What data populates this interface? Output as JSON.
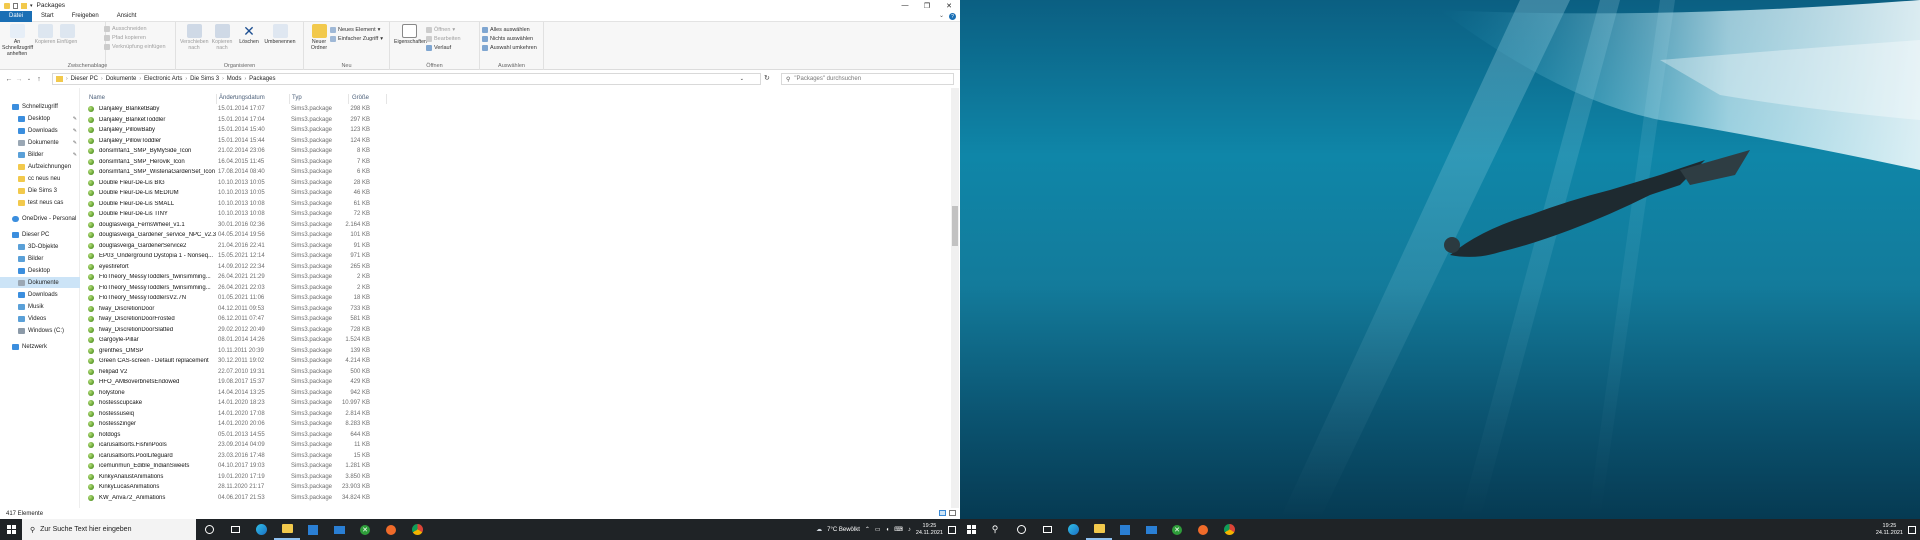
{
  "window": {
    "title": "Packages",
    "qa_dropdown": "▾",
    "minimize": "—",
    "maximize": "❐",
    "close": "✕",
    "help": "?"
  },
  "ribbon_tabs": [
    "Datei",
    "Start",
    "Freigeben",
    "Ansicht"
  ],
  "ribbon": {
    "pin_quick_access": "An Schnellzugriff anheften",
    "copy": "Kopieren",
    "paste": "Einfügen",
    "cut": "Ausschneiden",
    "copy_path": "Pfad kopieren",
    "paste_shortcut": "Verknüpfung einfügen",
    "group_clipboard": "Zwischenablage",
    "move_to": "Verschieben nach",
    "copy_to": "Kopieren nach",
    "delete": "Löschen",
    "rename": "Umbenennen",
    "group_organize": "Organisieren",
    "new_folder": "Neuer Ordner",
    "new_item": "Neues Element",
    "easy_access": "Einfacher Zugriff",
    "group_new": "Neu",
    "properties": "Eigenschaften",
    "open": "Öffnen",
    "edit": "Bearbeiten",
    "history": "Verlauf",
    "group_open": "Öffnen",
    "select_all": "Alles auswählen",
    "select_none": "Nichts auswählen",
    "invert_selection": "Auswahl umkehren",
    "group_select": "Auswählen"
  },
  "address": {
    "back": "←",
    "forward": "→",
    "recent": "⌄",
    "up": "↑",
    "crumbs": [
      "Dieser PC",
      "Dokumente",
      "Electronic Arts",
      "Die Sims 3",
      "Mods",
      "Packages"
    ],
    "dropdown": "⌄",
    "refresh": "↻",
    "search_placeholder": "\"Packages\" durchsuchen"
  },
  "nav_pane": {
    "quick_access": "Schnellzugriff",
    "desktop": "Desktop",
    "downloads": "Downloads",
    "documents": "Dokumente",
    "pictures": "Bilder",
    "recordings": "Aufzeichnungen",
    "cc_new": "cc neus neu",
    "sims3": "Die Sims 3",
    "test_cas": "test neus cas",
    "onedrive": "OneDrive - Personal",
    "this_pc": "Dieser PC",
    "objects3d": "3D-Objekte",
    "pc_pictures": "Bilder",
    "pc_desktop": "Desktop",
    "pc_documents": "Dokumente",
    "pc_downloads": "Downloads",
    "music": "Musik",
    "videos": "Videos",
    "windows_c": "Windows (C:)",
    "network": "Netzwerk"
  },
  "columns": {
    "name": "Name",
    "date": "Änderungsdatum",
    "type": "Typ",
    "size": "Größe",
    "sort_indicator": "^"
  },
  "files": [
    {
      "name": "Danjaley_BlanketBaby",
      "date": "15.01.2014 17:07",
      "type": "Sims3.package",
      "size": "298 KB"
    },
    {
      "name": "Danjaley_BlanketToddler",
      "date": "15.01.2014 17:04",
      "type": "Sims3.package",
      "size": "297 KB"
    },
    {
      "name": "Danjaley_PillowBaby",
      "date": "15.01.2014 15:40",
      "type": "Sims3.package",
      "size": "123 KB"
    },
    {
      "name": "Danjaley_PillowToddler",
      "date": "15.01.2014 15:44",
      "type": "Sims3.package",
      "size": "124 KB"
    },
    {
      "name": "donsimfan1_SMP_ByMySide_Icon",
      "date": "21.02.2014 23:06",
      "type": "Sims3.package",
      "size": "8 KB"
    },
    {
      "name": "donsimfan1_SMP_Herovik_Icon",
      "date": "16.04.2015 11:45",
      "type": "Sims3.package",
      "size": "7 KB"
    },
    {
      "name": "donsimfan1_SMP_WisteriaGardenSet_Icon",
      "date": "17.08.2014 08:40",
      "type": "Sims3.package",
      "size": "6 KB"
    },
    {
      "name": "Double Fleur-De-Lis BIG",
      "date": "10.10.2013 10:05",
      "type": "Sims3.package",
      "size": "28 KB"
    },
    {
      "name": "Double Fleur-De-Lis MEDIUM",
      "date": "10.10.2013 10:05",
      "type": "Sims3.package",
      "size": "46 KB"
    },
    {
      "name": "Double Fleur-De-Lis SMALL",
      "date": "10.10.2013 10:08",
      "type": "Sims3.package",
      "size": "61 KB"
    },
    {
      "name": "Double Fleur-De-Lis TINY",
      "date": "10.10.2013 10:08",
      "type": "Sims3.package",
      "size": "72 KB"
    },
    {
      "name": "douglasveiga_FerrisWheel_v1.1",
      "date": "30.01.2016 02:36",
      "type": "Sims3.package",
      "size": "2.164 KB"
    },
    {
      "name": "douglasveiga_Gardener_service_NPC_v2.3",
      "date": "04.05.2014 19:56",
      "type": "Sims3.package",
      "size": "101 KB"
    },
    {
      "name": "douglasveiga_GardenerService2",
      "date": "21.04.2016 22:41",
      "type": "Sims3.package",
      "size": "91 KB"
    },
    {
      "name": "EP03_Underground Dystopia 1 - Nonseq...",
      "date": "15.05.2021 12:14",
      "type": "Sims3.package",
      "size": "971 KB"
    },
    {
      "name": "eyesfirefort",
      "date": "14.09.2012 22:34",
      "type": "Sims3.package",
      "size": "265 KB"
    },
    {
      "name": "FloTheory_MessyToddlers_twinsimming...",
      "date": "26.04.2021 21:29",
      "type": "Sims3.package",
      "size": "2 KB"
    },
    {
      "name": "FloTheory_MessyToddlers_twinsimming...",
      "date": "26.04.2021 22:03",
      "type": "Sims3.package",
      "size": "2 KB"
    },
    {
      "name": "FloTheory_MessyToddlersV2.7N",
      "date": "01.05.2021 11:06",
      "type": "Sims3.package",
      "size": "18 KB"
    },
    {
      "name": "fway_DiscretionDoor",
      "date": "04.12.2011 09:53",
      "type": "Sims3.package",
      "size": "733 KB"
    },
    {
      "name": "fway_DiscretionDoorFrosted",
      "date": "06.12.2011 07:47",
      "type": "Sims3.package",
      "size": "581 KB"
    },
    {
      "name": "fway_DiscretionDoorSlatted",
      "date": "29.02.2012 20:49",
      "type": "Sims3.package",
      "size": "728 KB"
    },
    {
      "name": "Gargoyle-Pillar",
      "date": "08.01.2014 14:26",
      "type": "Sims3.package",
      "size": "1.524 KB"
    },
    {
      "name": "grenthes_OMSP",
      "date": "10.11.2011 20:39",
      "type": "Sims3.package",
      "size": "139 KB"
    },
    {
      "name": "Green CAS-screen - Default replacement",
      "date": "30.12.2011 19:02",
      "type": "Sims3.package",
      "size": "4.214 KB"
    },
    {
      "name": "helipad V2",
      "date": "22.07.2010 19:31",
      "type": "Sims3.package",
      "size": "500 KB"
    },
    {
      "name": "HFO_AMBoverbrietsEndowed",
      "date": "19.08.2017 15:37",
      "type": "Sims3.package",
      "size": "429 KB"
    },
    {
      "name": "holystone",
      "date": "14.04.2014 13:25",
      "type": "Sims3.package",
      "size": "942 KB"
    },
    {
      "name": "hostesscupcake",
      "date": "14.01.2020 18:23",
      "type": "Sims3.package",
      "size": "10.997 KB"
    },
    {
      "name": "hostessuseiq",
      "date": "14.01.2020 17:08",
      "type": "Sims3.package",
      "size": "2.814 KB"
    },
    {
      "name": "hostesszinger",
      "date": "14.01.2020 20:06",
      "type": "Sims3.package",
      "size": "8.283 KB"
    },
    {
      "name": "hotdogs",
      "date": "05.01.2013 14:55",
      "type": "Sims3.package",
      "size": "644 KB"
    },
    {
      "name": "icarusallsorts.FishinPools",
      "date": "23.09.2014 04:09",
      "type": "Sims3.package",
      "size": "11 KB"
    },
    {
      "name": "icarusallsorts.PoolLifeguard",
      "date": "23.03.2016 17:48",
      "type": "Sims3.package",
      "size": "15 KB"
    },
    {
      "name": "icemunmun_Edible_IndianSweets",
      "date": "04.10.2017 19:03",
      "type": "Sims3.package",
      "size": "1.281 KB"
    },
    {
      "name": "KinkyAnalustAnimations",
      "date": "19.01.2020 17:19",
      "type": "Sims3.package",
      "size": "3.850 KB"
    },
    {
      "name": "KinkyLucasAnimations",
      "date": "28.11.2020 21:17",
      "type": "Sims3.package",
      "size": "23.903 KB"
    },
    {
      "name": "KW_Anva72_Animations",
      "date": "04.06.2017 21:53",
      "type": "Sims3.package",
      "size": "34.824 KB"
    }
  ],
  "status": {
    "count": "417 Elemente"
  },
  "taskbar": {
    "search_placeholder": "Zur Suche Text hier eingeben",
    "weather": "7°C  Bewölkt",
    "time": "19:25",
    "date": "24.11.2021"
  },
  "colors": {
    "accent": "#1a6fb5",
    "selection": "#cce4f7",
    "taskbar": "#1f2326"
  }
}
